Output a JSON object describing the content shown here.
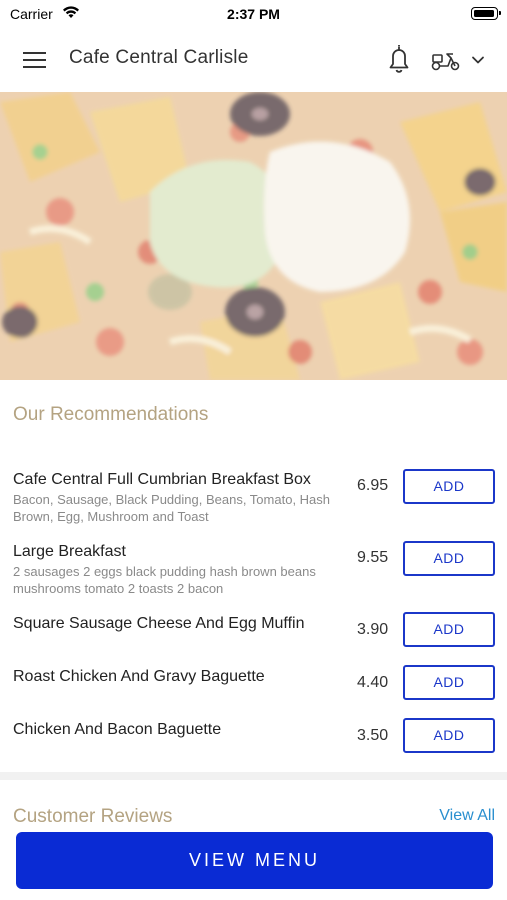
{
  "status_bar": {
    "carrier": "Carrier",
    "time": "2:37 PM"
  },
  "header": {
    "title": "Cafe Central Carlisle",
    "icons": [
      "menu-icon",
      "bell-icon",
      "scooter-icon",
      "chevron-down-icon"
    ]
  },
  "hero": {
    "image": "nachos-with-guacamole-and-sour-cream"
  },
  "recommendations": {
    "title": "Our Recommendations",
    "add_label": "ADD",
    "items": [
      {
        "name": "Cafe Central Full Cumbrian Breakfast Box",
        "description": "Bacon, Sausage, Black Pudding, Beans, Tomato, Hash Brown, Egg, Mushroom and Toast",
        "price": "6.95"
      },
      {
        "name": "Large Breakfast",
        "description": "2 sausages 2 eggs black pudding hash brown beans mushrooms tomato 2 toasts 2 bacon",
        "price": "9.55"
      },
      {
        "name": "Square Sausage Cheese And Egg Muffin",
        "description": "",
        "price": "3.90"
      },
      {
        "name": "Roast Chicken And Gravy Baguette",
        "description": "",
        "price": "4.40"
      },
      {
        "name": "Chicken And Bacon Baguette",
        "description": "",
        "price": "3.50"
      }
    ]
  },
  "reviews": {
    "title": "Customer Reviews",
    "view_all": "View All"
  },
  "footer": {
    "view_menu": "VIEW MENU"
  },
  "colors": {
    "accent_blue": "#0a2bd4",
    "button_outline": "#1b37c9",
    "section_title": "#b4a382",
    "link": "#2a8fcf"
  }
}
